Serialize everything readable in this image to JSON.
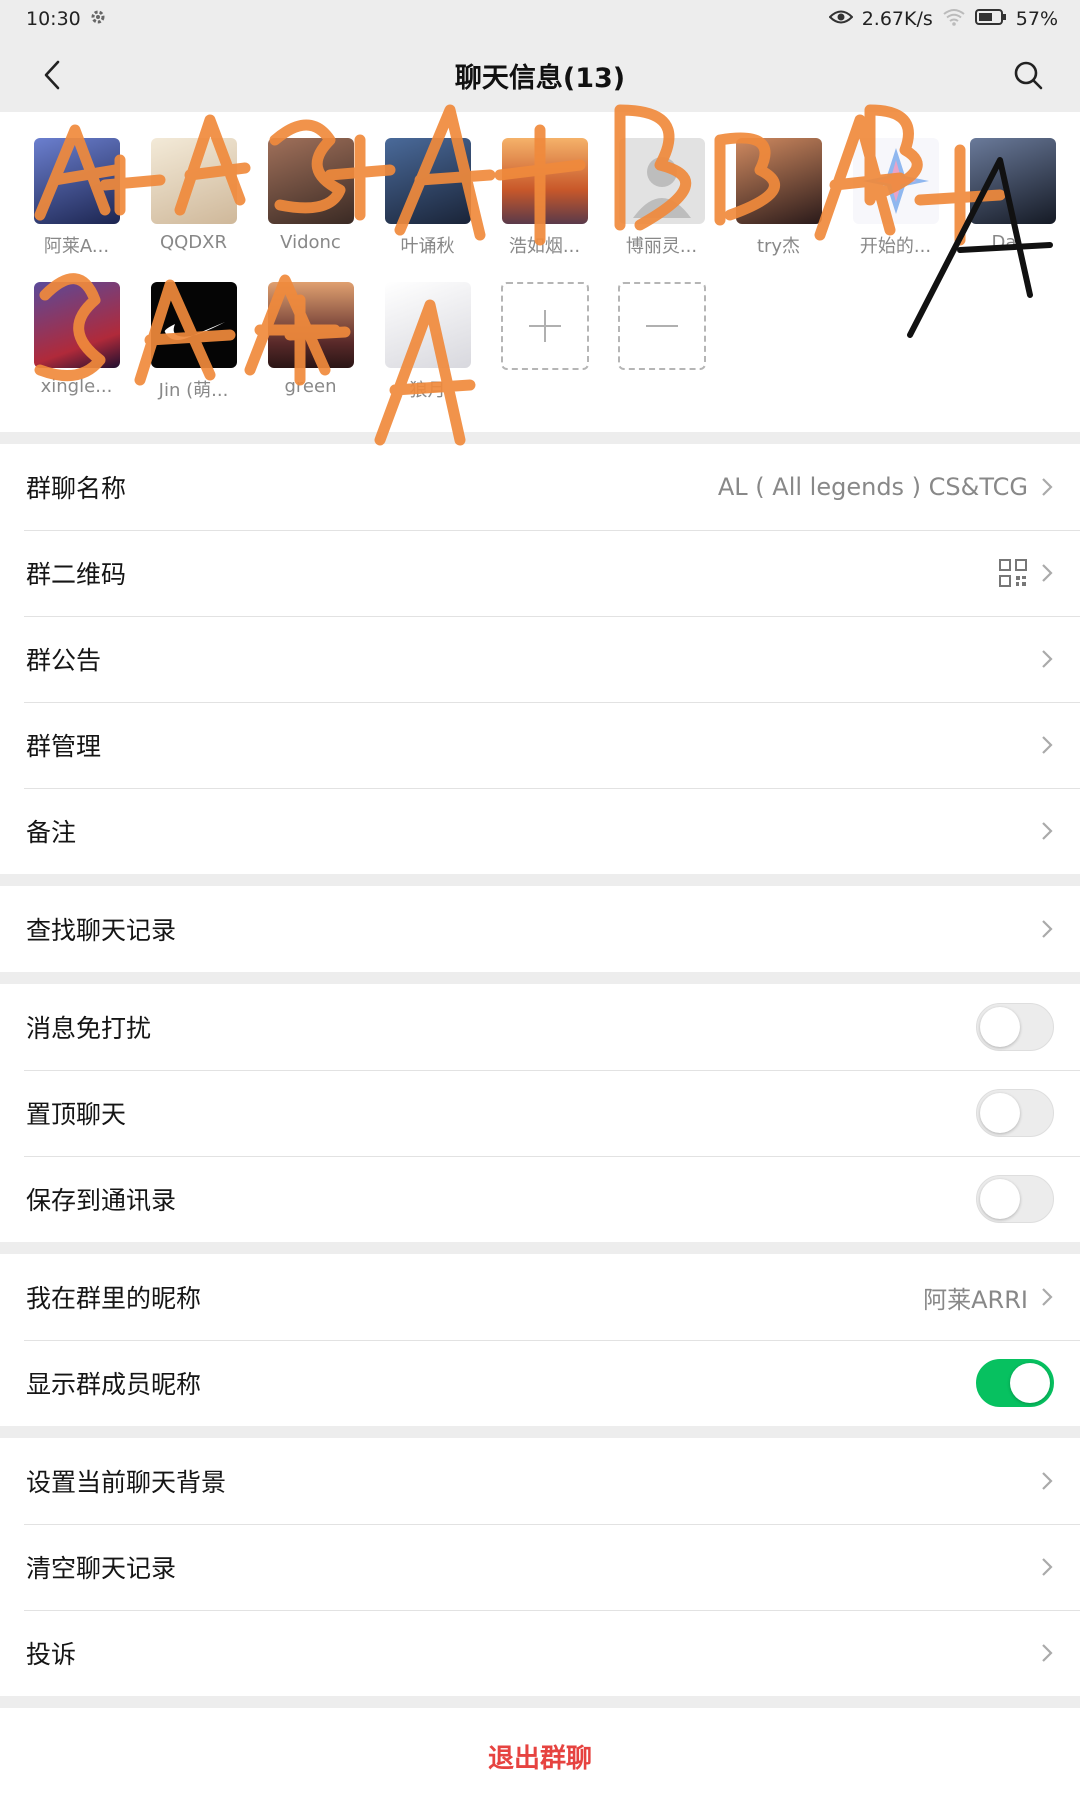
{
  "status_bar": {
    "time": "10:30",
    "network_speed": "2.67K/s",
    "battery": "57%"
  },
  "header": {
    "title": "聊天信息(13)"
  },
  "members": [
    {
      "name": "阿莱A...",
      "avatar_color": "#3a4a8a"
    },
    {
      "name": "QQDXR",
      "avatar_color": "#e8dcc8"
    },
    {
      "name": "Vidonc",
      "avatar_color": "#6a5040"
    },
    {
      "name": "叶诵秋",
      "avatar_color": "#2c3e60"
    },
    {
      "name": "浩如烟...",
      "avatar_color": "#e48a40"
    },
    {
      "name": "博丽灵...",
      "avatar_color": "#d0d0d0"
    },
    {
      "name": "try杰",
      "avatar_color": "#3a3030"
    },
    {
      "name": "开始的...",
      "avatar_color": "#f2f2f8"
    },
    {
      "name": "Da...",
      "avatar_color": "#2a3040"
    },
    {
      "name": "xingle...",
      "avatar_color": "#202040"
    },
    {
      "name": "Jin (萌...",
      "avatar_color": "#0a0a0a"
    },
    {
      "name": "green",
      "avatar_color": "#5a3a30"
    },
    {
      "name": "狼月",
      "avatar_color": "#f4f4f4"
    }
  ],
  "settings": {
    "group_name": {
      "label": "群聊名称",
      "value": "AL ( All legends ) CS&TCG"
    },
    "qr_code": {
      "label": "群二维码"
    },
    "announcement": {
      "label": "群公告"
    },
    "management": {
      "label": "群管理"
    },
    "remark": {
      "label": "备注"
    },
    "search_history": {
      "label": "查找聊天记录"
    },
    "mute": {
      "label": "消息免打扰",
      "enabled": false
    },
    "pin": {
      "label": "置顶聊天",
      "enabled": false
    },
    "save_contacts": {
      "label": "保存到通讯录",
      "enabled": false
    },
    "my_nickname": {
      "label": "我在群里的昵称",
      "value": "阿莱ARRI"
    },
    "show_nicknames": {
      "label": "显示群成员昵称",
      "enabled": true
    },
    "background": {
      "label": "设置当前聊天背景"
    },
    "clear_history": {
      "label": "清空聊天记录"
    },
    "report": {
      "label": "投诉"
    }
  },
  "exit_label": "退出群聊",
  "colors": {
    "accent_green": "#07c160",
    "danger_red": "#e64340",
    "annotation_orange": "#f08a3c"
  }
}
